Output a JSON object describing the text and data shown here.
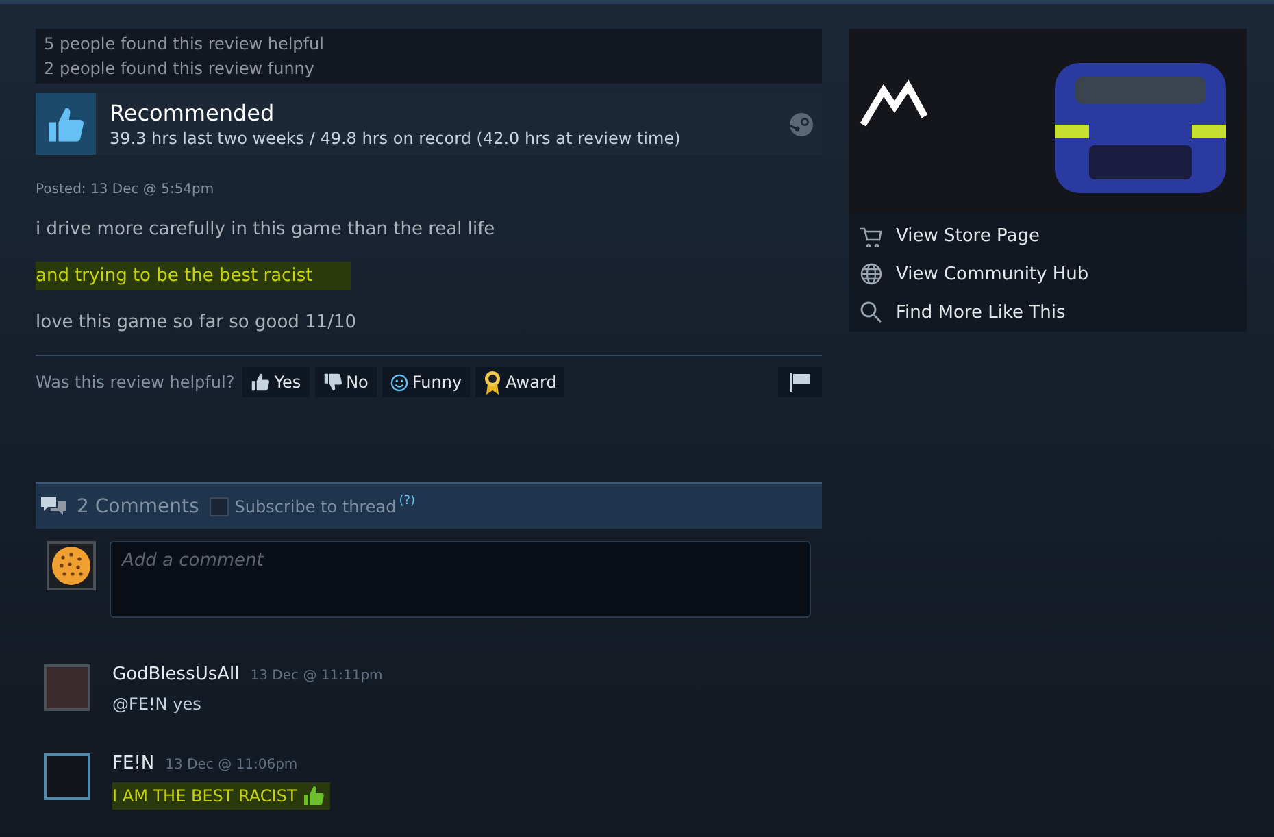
{
  "review": {
    "helpful_counts": [
      "5 people found this review helpful",
      "2 people found this review funny"
    ],
    "verdict": "Recommended",
    "hours": "39.3 hrs last two weeks / 49.8 hrs on record (42.0 hrs at review time)",
    "posted": "Posted: 13 Dec @ 5:54pm",
    "paragraphs": [
      {
        "text": "i drive more carefully in this game than the real life",
        "highlighted": false
      },
      {
        "text": "and trying to be the best racist",
        "highlighted": true
      },
      {
        "text": "love this game so far so good 11/10",
        "highlighted": false
      }
    ],
    "vote_prompt": "Was this review helpful?",
    "vote_buttons": [
      {
        "kind": "yes",
        "label": "Yes"
      },
      {
        "kind": "no",
        "label": "No"
      },
      {
        "kind": "funny",
        "label": "Funny"
      },
      {
        "kind": "award",
        "label": "Award"
      }
    ]
  },
  "comments_header": {
    "count": "2 Comments",
    "subscribe": "Subscribe to thread",
    "subscribed": false,
    "help": "(?)"
  },
  "comment_box": {
    "placeholder": "Add a comment"
  },
  "comments": [
    {
      "author": "GodBlessUsAll",
      "time": "13 Dec @ 11:11pm",
      "text": "@FE!N yes",
      "highlighted": false,
      "emoticon": false,
      "online": false
    },
    {
      "author": "FE!N",
      "time": "13 Dec @ 11:06pm",
      "text": "I AM THE BEST RACIST",
      "highlighted": true,
      "emoticon": true,
      "online": true
    }
  ],
  "sidebar": {
    "links": [
      {
        "kind": "store",
        "label": "View Store Page"
      },
      {
        "kind": "hub",
        "label": "View Community Hub"
      },
      {
        "kind": "similar",
        "label": "Find More Like This"
      }
    ]
  }
}
